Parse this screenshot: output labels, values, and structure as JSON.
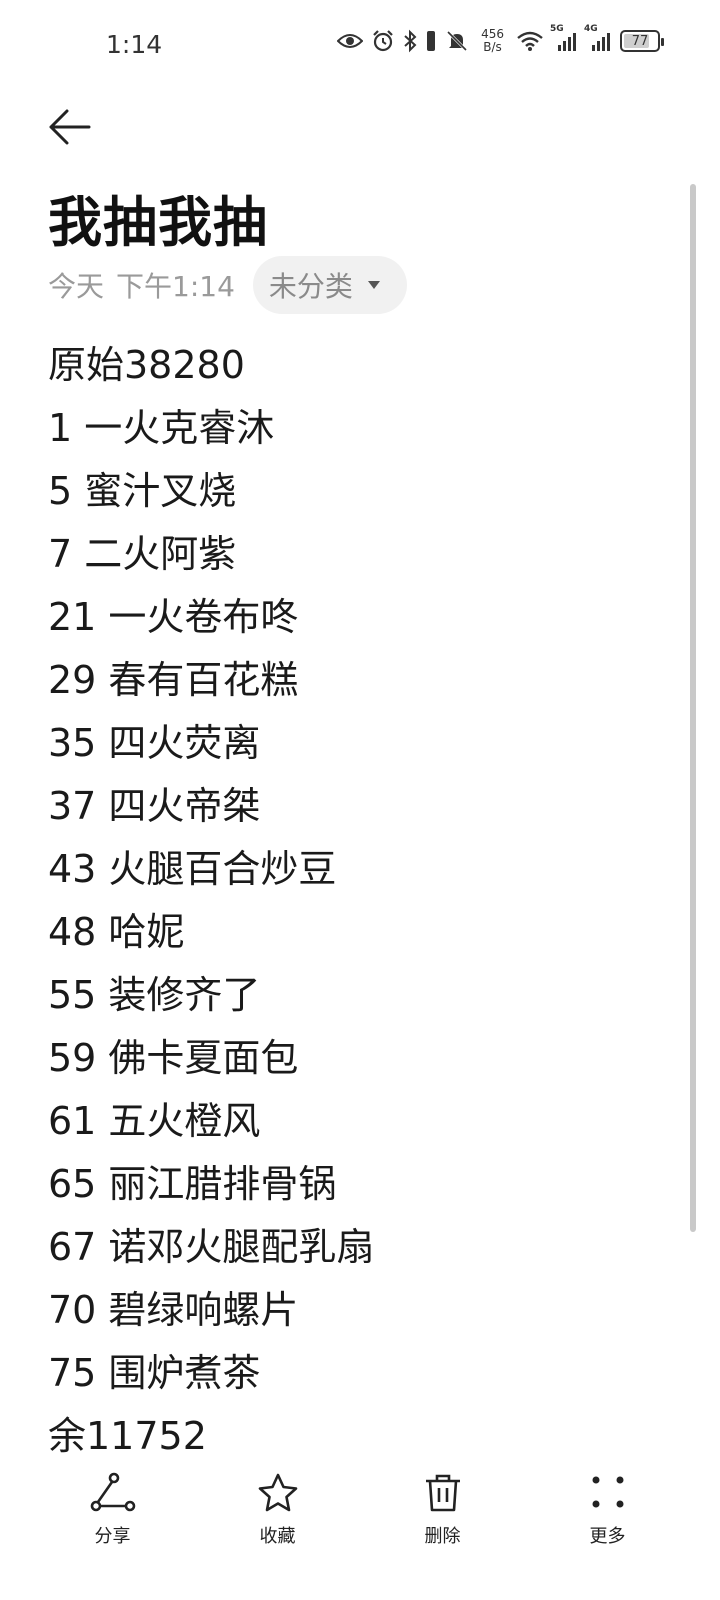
{
  "status_bar": {
    "time": "1:14",
    "net_speed_value": "456",
    "net_speed_unit": "B/s",
    "signal1_type": "5G",
    "signal2_type": "4G",
    "battery_percent": "77",
    "battery_level": 0.77,
    "icons": [
      "eye-icon",
      "alarm-icon",
      "bluetooth-icon",
      "mute-icon",
      "wifi-icon",
      "signal-icon",
      "battery-icon"
    ]
  },
  "note": {
    "title": "我抽我抽",
    "date": "今天",
    "time": "下午1:14",
    "category": "未分类",
    "lines": [
      "原始38280",
      "1 一火克睿沐",
      "5 蜜汁叉烧",
      "7 二火阿紫",
      "21 一火卷布咚",
      "29 春有百花糕",
      "35 四火荧离",
      "37 四火帝桀",
      "43 火腿百合炒豆",
      "48 哈妮",
      "55 装修齐了",
      "59 佛卡夏面包",
      "61 五火橙风",
      "65 丽江腊排骨锅",
      "67 诺邓火腿配乳扇",
      "70 碧绿响螺片",
      "75 围炉煮茶",
      "余11752"
    ]
  },
  "toolbar": {
    "share_label": "分享",
    "favorite_label": "收藏",
    "delete_label": "删除",
    "more_label": "更多"
  }
}
